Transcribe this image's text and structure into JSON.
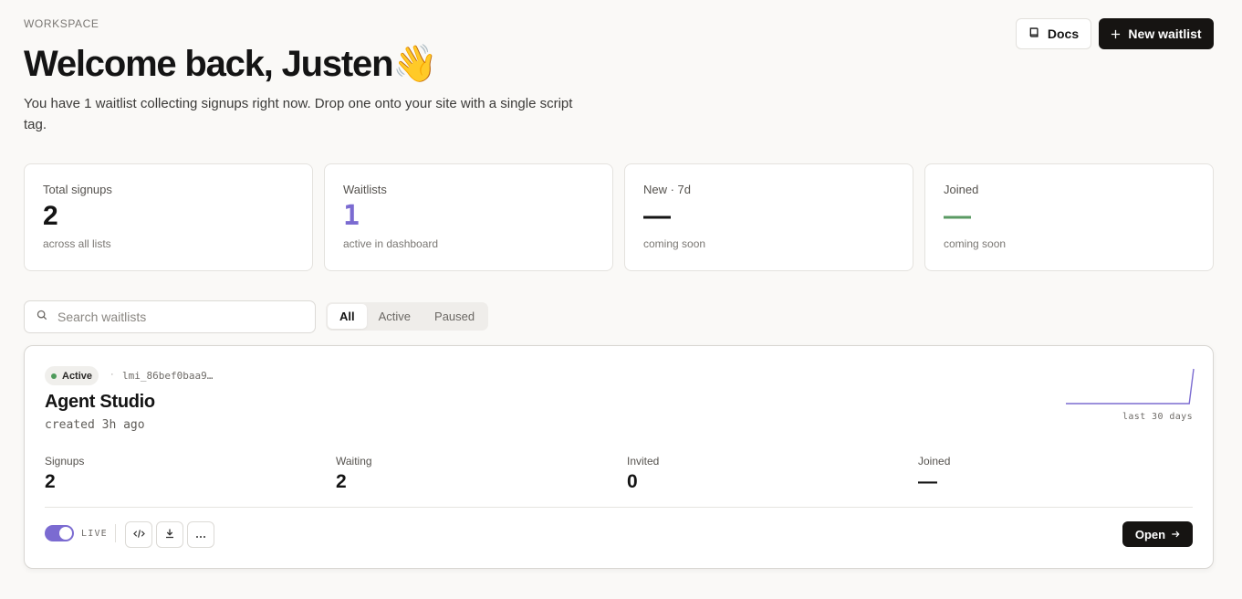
{
  "header": {
    "eyebrow": "WORKSPACE",
    "title": "Welcome back, Justen",
    "emoji": "👋",
    "subtitle": "You have 1 waitlist collecting signups right now. Drop one onto your site with a single script tag.",
    "docs_label": "Docs",
    "new_waitlist_label": "New waitlist"
  },
  "stats": [
    {
      "label": "Total signups",
      "value": "2",
      "sub": "across all lists"
    },
    {
      "label": "Waitlists",
      "value": "1",
      "sub": "active in dashboard"
    },
    {
      "label": "New · 7d",
      "value": "—",
      "sub": "coming soon"
    },
    {
      "label": "Joined",
      "value": "—",
      "sub": "coming soon"
    }
  ],
  "search": {
    "placeholder": "Search waitlists"
  },
  "filters": {
    "tabs": [
      "All",
      "Active",
      "Paused"
    ],
    "selected": "All"
  },
  "waitlist": {
    "status": "Active",
    "id": "lmi_86bef0baa9…",
    "name": "Agent Studio",
    "created": "created 3h ago",
    "sparkline_label": "last 30 days",
    "sparkline_values": [
      0,
      0,
      0,
      0,
      0,
      0,
      0,
      0,
      0,
      0,
      0,
      0,
      0,
      0,
      0,
      0,
      0,
      0,
      0,
      0,
      0,
      0,
      0,
      0,
      0,
      0,
      0,
      0,
      0,
      2
    ],
    "metrics": [
      {
        "label": "Signups",
        "value": "2"
      },
      {
        "label": "Waiting",
        "value": "2"
      },
      {
        "label": "Invited",
        "value": "0"
      },
      {
        "label": "Joined",
        "value": "—"
      }
    ],
    "live_label": "LIVE",
    "live_on": true,
    "open_label": "Open"
  },
  "colors": {
    "accent": "#7b6bd1",
    "primary_button": "#161412",
    "status_active": "#4e9a5b",
    "joined_dash": "#5a9a63"
  }
}
